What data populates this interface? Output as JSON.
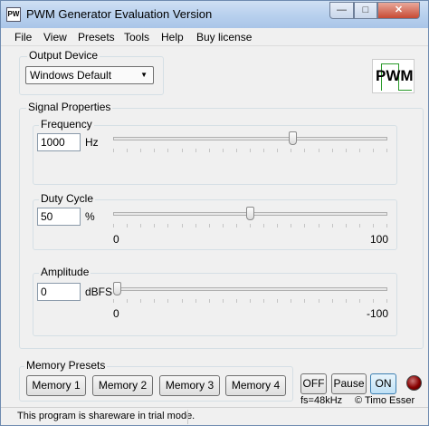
{
  "window": {
    "icon_text": "PW",
    "title": "PWM Generator Evaluation Version",
    "min_glyph": "—",
    "max_glyph": "□",
    "close_glyph": "✕"
  },
  "menu": [
    "File",
    "View",
    "Presets",
    "Tools",
    "Help",
    "Buy license"
  ],
  "output_device": {
    "label": "Output Device",
    "selected": "Windows Default",
    "arrow": "▼"
  },
  "logo_text": "PWM",
  "signal": {
    "label": "Signal Properties",
    "frequency": {
      "label": "Frequency",
      "value": "1000",
      "unit": "Hz",
      "slider_fraction": 0.66
    },
    "duty_cycle": {
      "label": "Duty Cycle",
      "value": "50",
      "unit": "%",
      "slider_fraction": 0.5,
      "scale_min": "0",
      "scale_max": "100"
    },
    "amplitude": {
      "label": "Amplitude",
      "value": "0",
      "unit": "dBFS",
      "slider_fraction": 0.0,
      "scale_min": "0",
      "scale_max": "-100"
    }
  },
  "memory": {
    "label": "Memory Presets",
    "buttons": [
      "Memory 1",
      "Memory 2",
      "Memory 3",
      "Memory 4"
    ]
  },
  "transport": {
    "off": "OFF",
    "pause": "Pause",
    "on": "ON"
  },
  "sample_rate": "fs=48kHz",
  "copyright": "© Timo Esser",
  "status": "This program is shareware in trial mode."
}
